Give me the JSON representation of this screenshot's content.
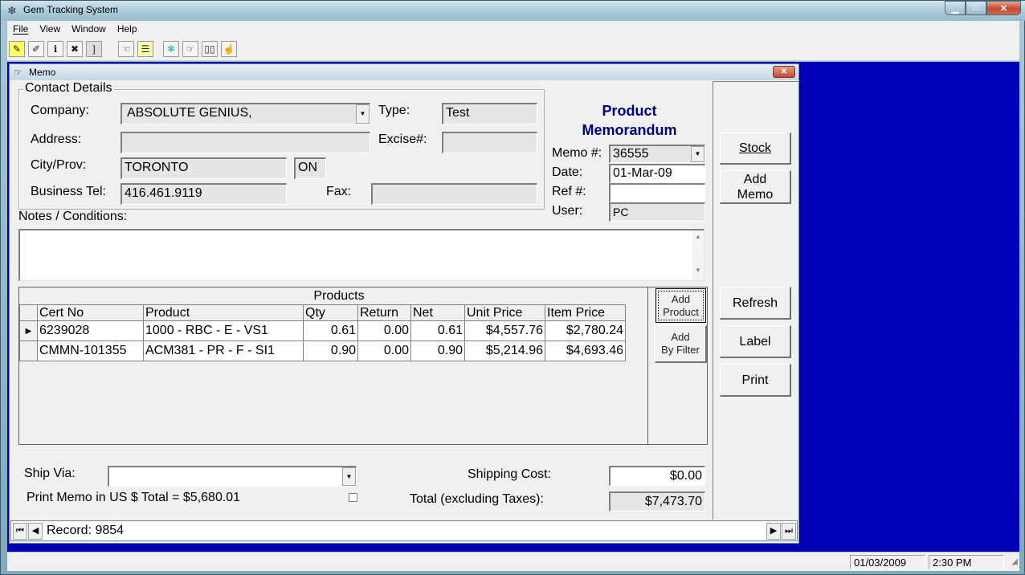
{
  "app": {
    "title": "Gem Tracking System",
    "icon": "snowflake-icon"
  },
  "menu": [
    {
      "label": "File",
      "accel": "F"
    },
    {
      "label": "View",
      "accel": "V"
    },
    {
      "label": "Window",
      "accel": "W"
    },
    {
      "label": "Help",
      "accel": "H"
    }
  ],
  "toolbar": [
    {
      "name": "note-icon",
      "glyph": "✎"
    },
    {
      "name": "edit-doc-icon",
      "glyph": "✐"
    },
    {
      "name": "info-doc-icon",
      "glyph": "ℹ"
    },
    {
      "name": "delete-doc-icon",
      "glyph": "✖"
    },
    {
      "name": "bracket-doc-icon",
      "glyph": "]"
    },
    {
      "name": "hand-left-icon",
      "glyph": "☜"
    },
    {
      "name": "list-doc-icon",
      "glyph": "☰"
    },
    {
      "name": "snowflake-icon",
      "glyph": "❄"
    },
    {
      "name": "hand-point-icon",
      "glyph": "☞"
    },
    {
      "name": "book-icon",
      "glyph": "📖"
    },
    {
      "name": "thumb-icon",
      "glyph": "👍"
    }
  ],
  "memo_window": {
    "title": "Memo",
    "icon": "hand-point-icon"
  },
  "contact": {
    "legend": "Contact Details",
    "company_label": "Company:",
    "company_value": "ABSOLUTE GENIUS,",
    "type_label": "Type:",
    "type_value": "Test",
    "address_label": "Address:",
    "address_value": "",
    "excise_label": "Excise#:",
    "excise_value": "",
    "city_label": "City/Prov:",
    "city_value": "TORONTO",
    "prov_value": "ON",
    "tel_label": "Business Tel:",
    "tel_value": "416.461.9119",
    "fax_label": "Fax:",
    "fax_value": ""
  },
  "memorandum": {
    "title_line1": "Product",
    "title_line2": "Memorandum",
    "memo_label": "Memo #:",
    "memo_value": "36555",
    "date_label": "Date:",
    "date_value": "01-Mar-09",
    "ref_label": "Ref #:",
    "ref_value": "",
    "user_label": "User:",
    "user_value": "PC"
  },
  "notes": {
    "label": "Notes / Conditions:",
    "value": ""
  },
  "products": {
    "caption": "Products",
    "columns": [
      "Cert No",
      "Product",
      "Qty",
      "Return",
      "Net",
      "Unit Price",
      "Item Price"
    ],
    "rows": [
      {
        "selected": true,
        "cert": "6239028",
        "product": "1000 - RBC - E - VS1",
        "qty": "0.61",
        "return": "0.00",
        "net": "0.61",
        "unit_price": "$4,557.76",
        "item_price": "$2,780.24"
      },
      {
        "selected": false,
        "cert": "CMMN-101355",
        "product": "ACM381 - PR - F - SI1",
        "qty": "0.90",
        "return": "0.00",
        "net": "0.90",
        "unit_price": "$5,214.96",
        "item_price": "$4,693.46"
      }
    ],
    "add_product_line1": "Add",
    "add_product_line2": "Product",
    "add_filter_line1": "Add",
    "add_filter_line2": "By Filter"
  },
  "side_buttons": {
    "stock": "Stock",
    "add_memo_line1": "Add",
    "add_memo_line2": "Memo",
    "refresh": "Refresh",
    "label": "Label",
    "print": "Print"
  },
  "footer": {
    "ship_via_label": "Ship Via:",
    "ship_via_value": "",
    "print_us_label": "Print Memo in US $ Total = $5,680.01",
    "print_us_checked": false,
    "shipping_cost_label": "Shipping Cost:",
    "shipping_cost_value": "$0.00",
    "total_label": "Total (excluding Taxes):",
    "total_value": "$7,473.70"
  },
  "record_nav": {
    "text": "Record: 9854"
  },
  "statusbar": {
    "date": "01/03/2009",
    "time": "2:30 PM"
  }
}
